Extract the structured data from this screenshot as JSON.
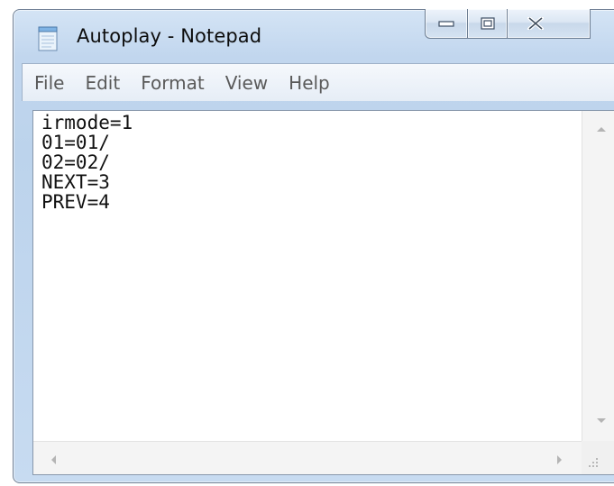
{
  "window": {
    "title": "Autoplay - Notepad",
    "app_icon": "notepad-icon",
    "caption_buttons": {
      "minimize_icon": "minimize-icon",
      "maximize_icon": "maximize-icon",
      "close_icon": "close-icon"
    }
  },
  "menubar": {
    "items": [
      {
        "label": "File"
      },
      {
        "label": "Edit"
      },
      {
        "label": "Format"
      },
      {
        "label": "View"
      },
      {
        "label": "Help"
      }
    ]
  },
  "editor": {
    "lines": [
      "irmode=1",
      "01=01/",
      "02=02/",
      "NEXT=3",
      "PREV=4"
    ]
  },
  "scrollbars": {
    "up_icon": "scroll-up-arrow-icon",
    "down_icon": "scroll-down-arrow-icon",
    "left_icon": "scroll-left-arrow-icon",
    "right_icon": "scroll-right-arrow-icon",
    "grip_icon": "size-grip-icon"
  },
  "colors": {
    "frame": "#c1d6ee",
    "frame_border": "#6f7f94",
    "menu_text": "#5a5a5a",
    "editor_text": "#111111"
  }
}
